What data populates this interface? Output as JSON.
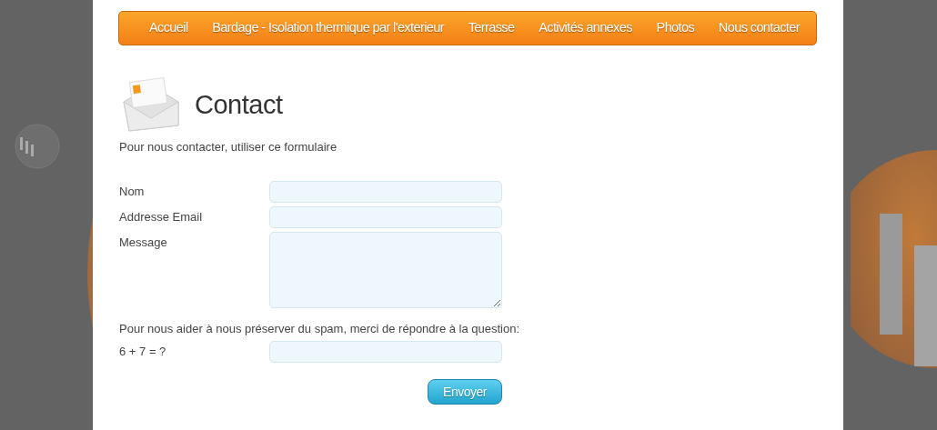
{
  "nav": [
    {
      "label": "Accueil",
      "selected": false
    },
    {
      "label": "Bardage - Isolation thermique par l'exterieur",
      "selected": false
    },
    {
      "label": "Terrasse",
      "selected": false
    },
    {
      "label": "Activités annexes",
      "selected": false
    },
    {
      "label": "Photos",
      "selected": false
    },
    {
      "label": "Nous contacter",
      "selected": false
    }
  ],
  "heading": "Contact",
  "intro": "Pour nous contacter, utiliser ce formulaire",
  "fields": [
    {
      "label": "Nom",
      "kind": "text"
    },
    {
      "label": "Addresse Email",
      "kind": "text"
    },
    {
      "label": "Message",
      "kind": "textarea"
    }
  ],
  "spam_note": "Pour nous aider à nous préserver du spam, merci de répondre à la question:",
  "captcha": {
    "label": "6 + 7 = ?"
  },
  "submit": "Envoyer"
}
